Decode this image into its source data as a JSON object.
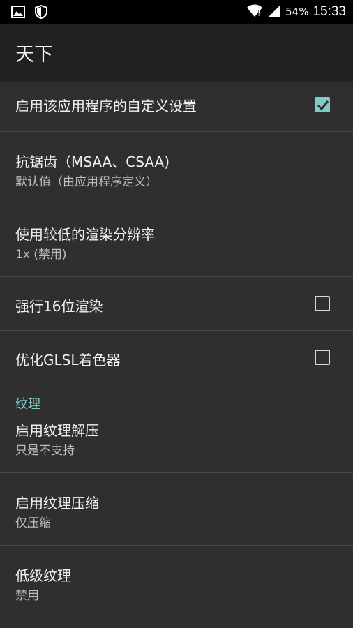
{
  "status_bar": {
    "left_icons": [
      "image-notification-icon",
      "shield-icon"
    ],
    "right_icons": [
      "wifi-icon",
      "signal-icon"
    ],
    "battery": "54%",
    "time": "15:33"
  },
  "toolbar": {
    "title": "天下"
  },
  "accent_color": "#80cbc4",
  "settings": [
    {
      "title": "启用该应用程序的自定义设置",
      "checkbox": true,
      "checked": true
    },
    {
      "title": "抗锯齿（MSAA、CSAA)",
      "summary": "默认值（由应用程序定义）"
    },
    {
      "title": "使用较低的渲染分辨率",
      "summary": "1x (禁用)"
    },
    {
      "title": "强行16位渲染",
      "checkbox": true,
      "checked": false
    },
    {
      "title": "优化GLSL着色器",
      "checkbox": true,
      "checked": false
    }
  ],
  "texture_section": {
    "header": "纹理",
    "items": [
      {
        "title": "启用纹理解压",
        "summary": "只是不支持"
      },
      {
        "title": "启用纹理压缩",
        "summary": "仅压缩"
      },
      {
        "title": "低级纹理",
        "summary": "禁用"
      }
    ]
  }
}
